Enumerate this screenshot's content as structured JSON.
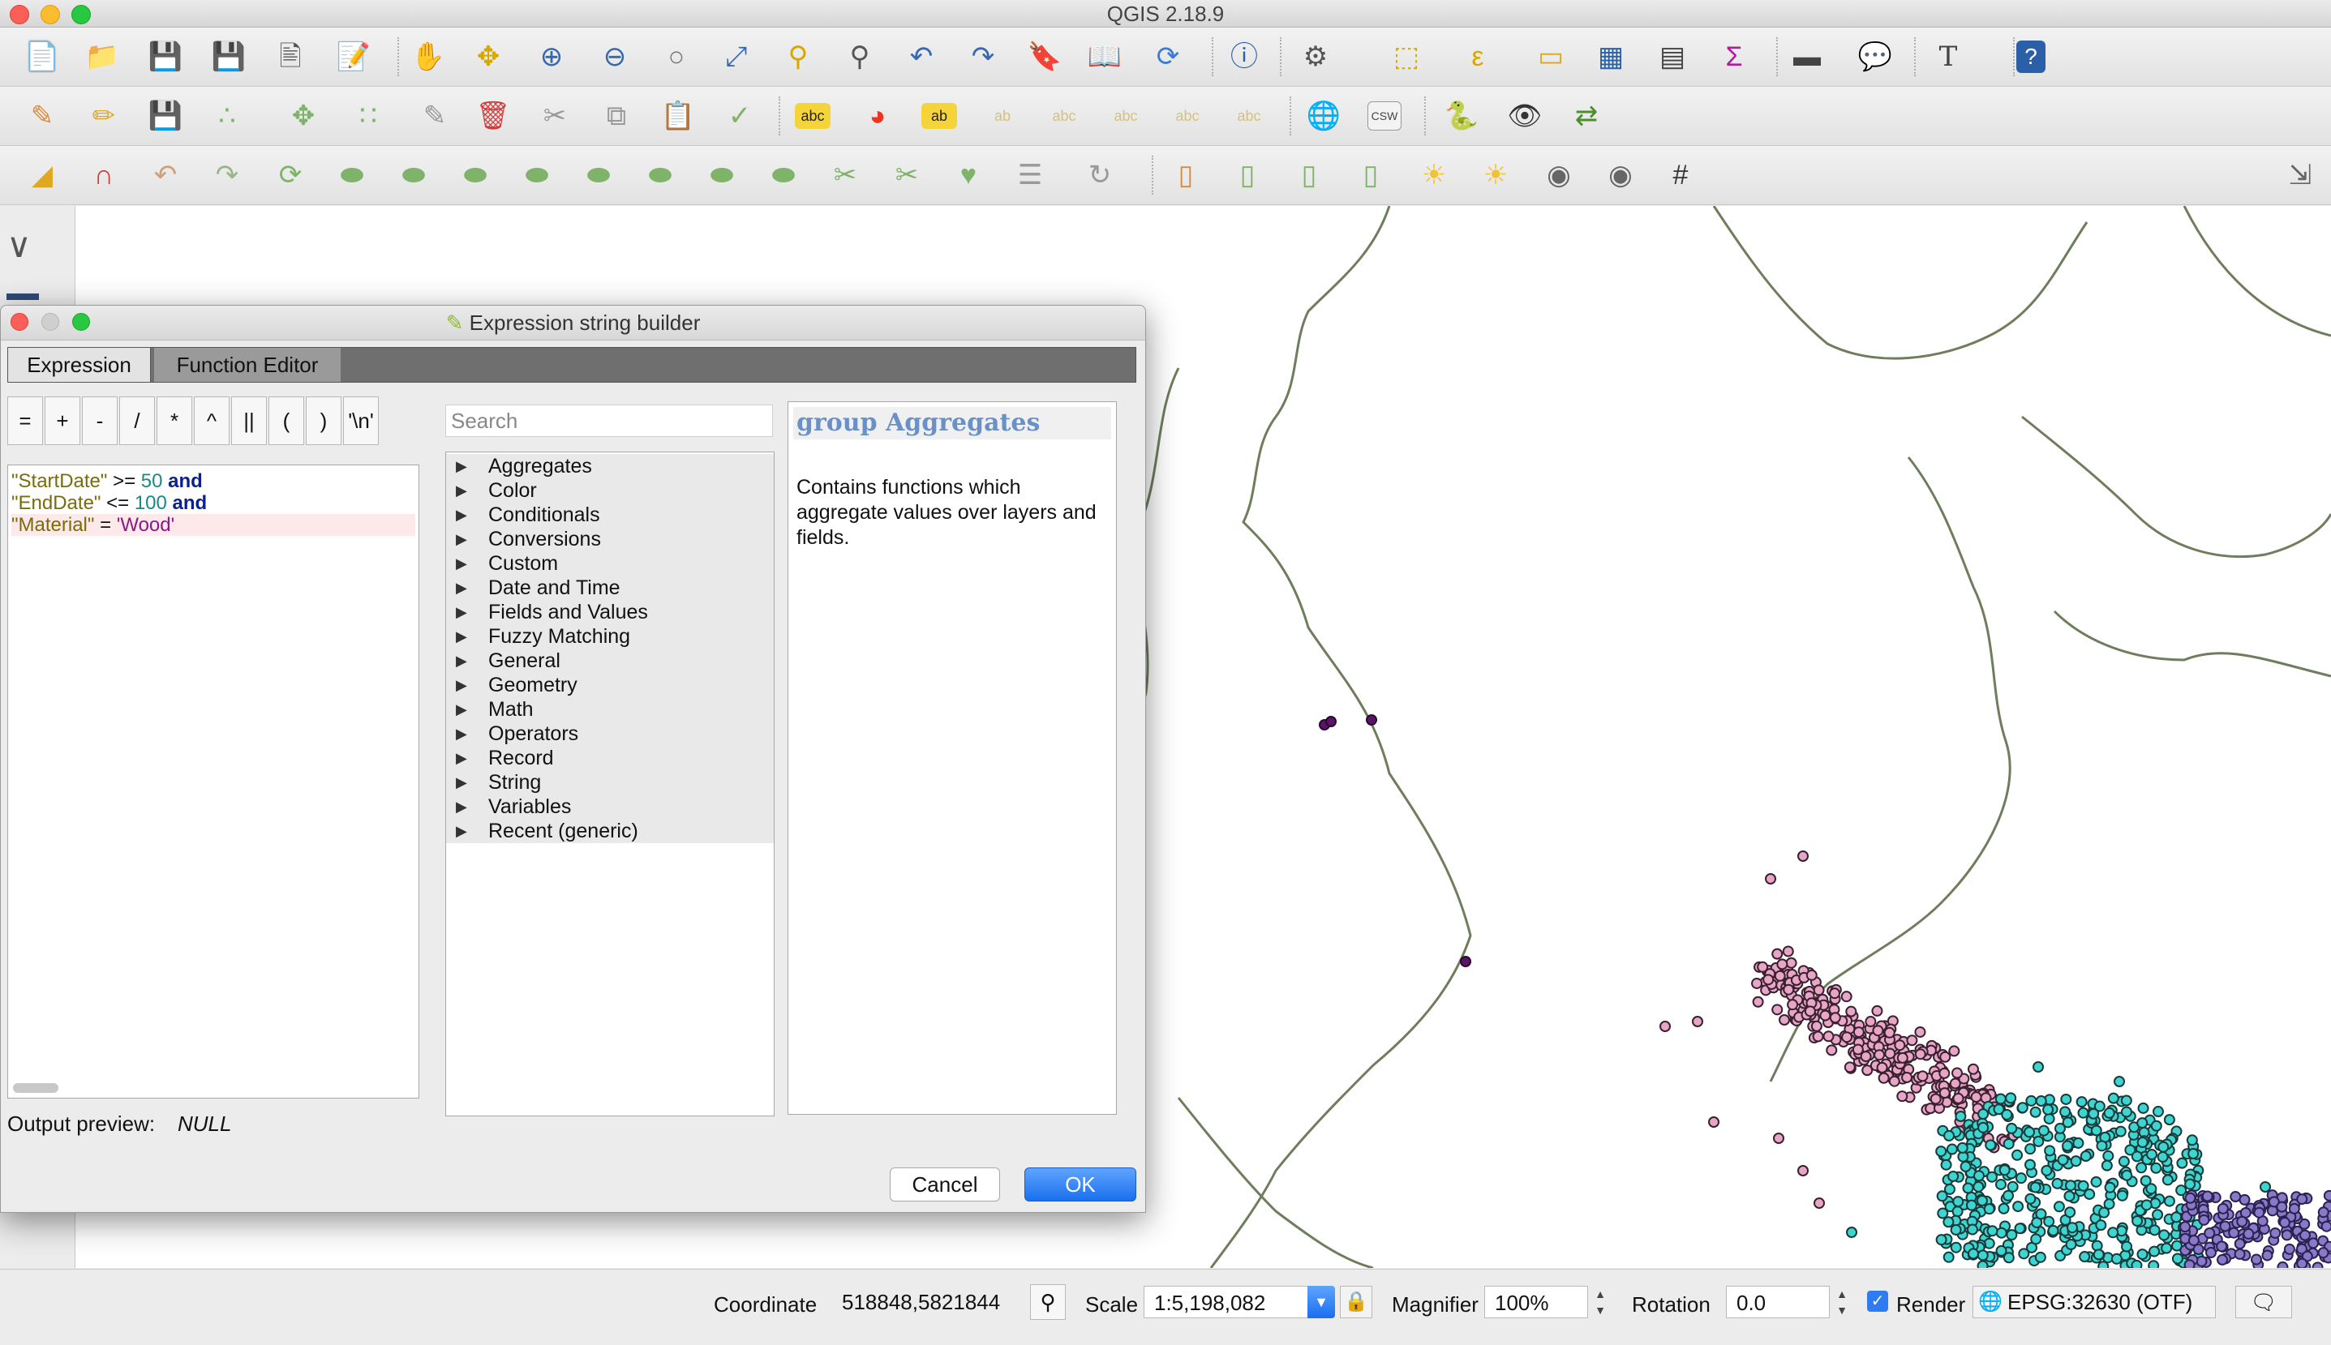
{
  "app": {
    "title": "QGIS 2.18.9"
  },
  "dialog": {
    "title": "Expression string builder",
    "tabs": [
      {
        "label": "Expression"
      },
      {
        "label": "Function Editor"
      }
    ],
    "operators": [
      "=",
      "+",
      "-",
      "/",
      "*",
      "^",
      "||",
      "(",
      ")",
      "'\\n'"
    ],
    "expression_lines": [
      [
        {
          "t": "\"StartDate\"",
          "c": "field"
        },
        {
          "t": " >= ",
          "c": "op"
        },
        {
          "t": "50",
          "c": "num"
        },
        {
          "t": " and",
          "c": "kw"
        }
      ],
      [
        {
          "t": "\"EndDate\"",
          "c": "field"
        },
        {
          "t": " <= ",
          "c": "op"
        },
        {
          "t": "100",
          "c": "num"
        },
        {
          "t": " and",
          "c": "kw"
        }
      ],
      [
        {
          "t": "\"Material\"",
          "c": "field"
        },
        {
          "t": " = ",
          "c": "op"
        },
        {
          "t": "'Wood'",
          "c": "str"
        }
      ]
    ],
    "search_placeholder": "Search",
    "function_groups": [
      "Aggregates",
      "Color",
      "Conditionals",
      "Conversions",
      "Custom",
      "Date and Time",
      "Fields and Values",
      "Fuzzy Matching",
      "General",
      "Geometry",
      "Math",
      "Operators",
      "Record",
      "String",
      "Variables",
      "Recent (generic)"
    ],
    "help": {
      "title": "group Aggregates",
      "body": "Contains functions which aggregate values over layers and fields."
    },
    "output_preview_label": "Output preview:",
    "output_preview_value": "NULL",
    "cancel_label": "Cancel",
    "ok_label": "OK"
  },
  "statusbar": {
    "coordinate_label": "Coordinate",
    "coordinate_value": "518848,5821844",
    "scale_label": "Scale",
    "scale_value": "1:5,198,082",
    "magnifier_label": "Magnifier",
    "magnifier_value": "100%",
    "rotation_label": "Rotation",
    "rotation_value": "0.0",
    "render_label": "Render",
    "render_checked": true,
    "crs_label": "EPSG:32630 (OTF)"
  },
  "colors": {
    "accent": "#1a6fee",
    "points_purple": "#5a1466",
    "points_pink": "#e7a6c6",
    "points_cyan": "#3fd4cf",
    "points_violet": "#8a78c8",
    "coastline": "#6f7d5c"
  }
}
